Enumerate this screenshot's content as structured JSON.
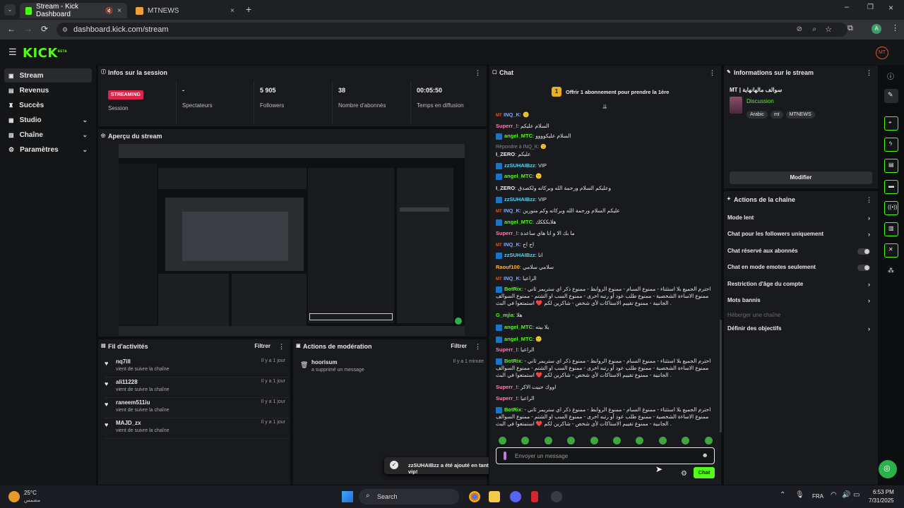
{
  "browser": {
    "tabs": [
      {
        "title": "Stream - Kick Dashboard",
        "active": true
      },
      {
        "title": "MTNEWS",
        "active": false
      }
    ],
    "url": "dashboard.kick.com/stream"
  },
  "kick": {
    "logo": "KICK",
    "logo_sup": "BETA",
    "avatar": "MT"
  },
  "sidebar": {
    "items": [
      {
        "label": "Stream",
        "icon": "broadcast-icon",
        "active": true
      },
      {
        "label": "Revenus",
        "icon": "wallet-icon"
      },
      {
        "label": "Succès",
        "icon": "trophy-icon"
      },
      {
        "label": "Studio",
        "icon": "studio-icon",
        "expandable": true
      },
      {
        "label": "Chaîne",
        "icon": "channel-icon",
        "expandable": true
      },
      {
        "label": "Paramètres",
        "icon": "gear-icon",
        "expandable": true
      }
    ]
  },
  "session": {
    "title": "Infos sur la session",
    "status_badge": "STREAMING",
    "status_label": "Session",
    "viewers_value": "-",
    "viewers_label": "Spectateurs",
    "followers_value": "5 905",
    "followers_label": "Followers",
    "subs_value": "38",
    "subs_label": "Nombre d'abonnés",
    "uptime_value": "00:05:50",
    "uptime_label": "Temps en diffusion"
  },
  "preview": {
    "title": "Aperçu du stream"
  },
  "activity": {
    "title": "Fil d'activités",
    "filter": "Filtrer",
    "items": [
      {
        "name": "nq7ill",
        "sub": "vient de suivre la chaîne",
        "time": "Il y a 1 jour"
      },
      {
        "name": "ali11228",
        "sub": "vient de suivre la chaîne",
        "time": "Il y a 1 jour"
      },
      {
        "name": "raneem511iu",
        "sub": "vient de suivre la chaîne",
        "time": "Il y a 1 jour"
      },
      {
        "name": "MAJD_zx",
        "sub": "vient de suivre la chaîne",
        "time": "Il y a 1 jour"
      }
    ]
  },
  "moderation": {
    "title": "Actions de modération",
    "filter": "Filtrer",
    "items": [
      {
        "name": "hoorisum",
        "sub": "a supprimé un message",
        "time": "Il y a 1 minute"
      }
    ]
  },
  "toast": {
    "text": "zzSUHAIBzz a été ajouté en tant que vip!"
  },
  "chat": {
    "title": "Chat",
    "gift_text": "Offrir 1 abonnement pour prendre la 1ère",
    "gift_count": "1",
    "input_placeholder": "Envoyer un message",
    "send_label": "Chat",
    "messages": [
      {
        "badge": "MT",
        "user": "INQ_K",
        "cls": "u-blue",
        "text": "🙂"
      },
      {
        "user": "Superr_!",
        "cls": "u-pink",
        "text": "السلام عليكم"
      },
      {
        "badge": "sq",
        "user": "angel_MTC",
        "cls": "u-green",
        "text": "السلام عليكوووو"
      },
      {
        "reply": "Répondre à INQ_K: 🙂",
        "user": "I_ZERO",
        "cls": "u-white",
        "text": "عليكم"
      },
      {
        "badge": "sq",
        "user": "zzSUHAIBzz",
        "cls": "u-cyan",
        "text": "VIP"
      },
      {
        "badge": "sq",
        "user": "angel_MTC",
        "cls": "u-green",
        "text": "🙂"
      },
      {
        "user": "I_ZERO",
        "cls": "u-white",
        "text": "وعليكم السلام ورحمة الله وبركاته ولكصدق"
      },
      {
        "badge": "sq",
        "user": "zzSUHAIBzz",
        "cls": "u-cyan",
        "text": "VIP"
      },
      {
        "badge": "MT",
        "user": "INQ_K",
        "cls": "u-blue",
        "text": "عليكم السلام ورحمة الله وبركاته وكم منورين"
      },
      {
        "badge": "sq",
        "user": "angel_MTC",
        "cls": "u-green",
        "text": "هلابكككك"
      },
      {
        "user": "Superr_!",
        "cls": "u-pink",
        "text": "ما بك الا و انا هاي ساعدة"
      },
      {
        "badge": "MT",
        "user": "INQ_K",
        "cls": "u-blue",
        "text": "اح اح"
      },
      {
        "badge": "sq",
        "user": "zzSUHAIBzz",
        "cls": "u-cyan",
        "text": "انا"
      },
      {
        "user": "Raouf100",
        "cls": "u-orange",
        "text": "سلامي سلامي"
      },
      {
        "badge": "MT",
        "user": "INQ_K",
        "cls": "u-blue",
        "text": "الراعيا"
      },
      {
        "badge": "sq",
        "user": "BotRix",
        "cls": "u-green",
        "text": "احترم الجميع بلا استثناء - ممنوع السبام - ممنوع الروابط - ممنوع ذكر اي ستريمر ثاني - ممنوع الاساءة الشخصية - ممنوع طلب عود أو رتبه اخرى - ممنوع السب او الشتم - ممنوع السوالف الجانبية - ممنوع تقييم الاستاكات لأي شخص - شاكرين لكم ❤️ استمتعوا في البث ."
      },
      {
        "user": "G_mjia",
        "cls": "u-green",
        "text": "هلا"
      },
      {
        "badge": "sq",
        "user": "angel_MTC",
        "cls": "u-green",
        "text": "يلا بيته"
      },
      {
        "badge": "sq",
        "user": "angel_MTC",
        "cls": "u-green",
        "text": "🙂"
      },
      {
        "user": "Superr_!",
        "cls": "u-pink",
        "text": "الراعيا"
      },
      {
        "badge": "sq",
        "user": "BotRix",
        "cls": "u-green",
        "text": "احترم الجميع بلا استثناء - ممنوع السبام - ممنوع الروابط - ممنوع ذكر اي ستريمر ثاني - ممنوع الاساءة الشخصية - ممنوع طلب عود أو رتبه اخرى - ممنوع السب او الشتم - ممنوع السوالف الجانبية - ممنوع تقييم الاستاكات لأي شخص - شاكرين لكم ❤️ استمتعوا في البث ."
      },
      {
        "user": "Superr_!",
        "cls": "u-pink",
        "text": "اووك حبيت الاكر"
      },
      {
        "user": "Superr_!",
        "cls": "u-pink",
        "text": "الراعيا"
      },
      {
        "badge": "sq",
        "user": "BotRix",
        "cls": "u-green",
        "text": "احترم الجميع بلا استثناء - ممنوع السبام - ممنوع الروابط - ممنوع ذكر اي ستريمر ثاني - ممنوع الاساءة الشخصية - ممنوع طلب عود أو رتبه اخرى - ممنوع السب او الشتم - ممنوع السوالف الجانبية - ممنوع تقييم الاستاكات لأي شخص - شاكرين لكم ❤️ استمتعوا في البث ."
      }
    ]
  },
  "stream_info": {
    "title": "Informations sur le stream",
    "stream_title": "MT | سوالف مالهانهاية",
    "category": "Discussion",
    "tags": [
      "Arabic",
      "mt",
      "MTNEWS"
    ],
    "edit_label": "Modifier"
  },
  "channel_actions": {
    "title": "Actions de la chaîne",
    "items": [
      {
        "label": "Mode lent",
        "kind": "chevron"
      },
      {
        "label": "Chat pour les followers uniquement",
        "kind": "chevron"
      },
      {
        "label": "Chat réservé aux abonnés",
        "kind": "toggle"
      },
      {
        "label": "Chat en mode emotes seulement",
        "kind": "toggle"
      },
      {
        "label": "Restriction d'âge du compte",
        "kind": "chevron"
      },
      {
        "label": "Mots bannis",
        "kind": "chevron"
      },
      {
        "label": "Héberger une chaîne",
        "kind": "disabled"
      },
      {
        "label": "Définir des objectifs",
        "kind": "chevron"
      }
    ]
  },
  "taskbar": {
    "weather_temp": "25°C",
    "weather_label": "مشمس",
    "search_label": "Search",
    "lang": "FRA",
    "time": "6:53 PM",
    "date": "7/31/2025"
  },
  "colors": {
    "accent": "#53fc18",
    "live": "#d7264a",
    "panel": "#191a1d"
  }
}
